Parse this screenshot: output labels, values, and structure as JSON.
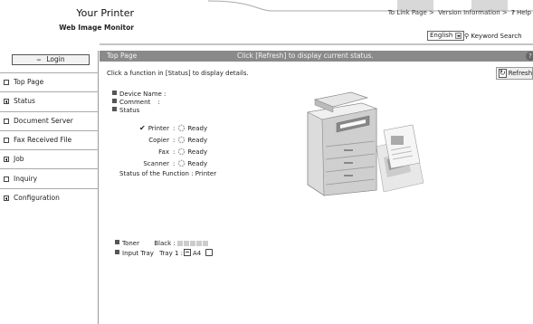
{
  "header": {
    "title": "Your Printer",
    "subtitle": "Web Image Monitor",
    "links": [
      "To Link Page >",
      "Version Information >",
      "Help"
    ],
    "help_icon": "question-icon",
    "language": "English",
    "keyword_search": "Keyword Search"
  },
  "sidebar": {
    "login": "Login",
    "items": [
      {
        "label": "Top Page",
        "icon": "page-box-icon"
      },
      {
        "label": "Status",
        "icon": "plus-box-icon"
      },
      {
        "label": "Document Server",
        "icon": "page-box-icon"
      },
      {
        "label": "Fax Received File",
        "icon": "page-box-icon"
      },
      {
        "label": "Job",
        "icon": "plus-box-icon"
      },
      {
        "label": "Inquiry",
        "icon": "page-box-icon"
      },
      {
        "label": "Configuration",
        "icon": "plus-box-icon"
      }
    ]
  },
  "main": {
    "bar_title": "Top Page",
    "bar_message": "Click [Refresh] to display current status.",
    "instruction": "Click a function in [Status] to display details.",
    "refresh_label": "Refresh",
    "device_name_label": "Device Name :",
    "comment_label": "Comment",
    "comment_colon": ":",
    "status_label": "Status",
    "functions": [
      {
        "name": "Printer",
        "state": "Ready",
        "checked": true
      },
      {
        "name": "Copier",
        "state": "Ready",
        "checked": false
      },
      {
        "name": "Fax",
        "state": "Ready",
        "checked": false
      },
      {
        "name": "Scanner",
        "state": "Ready",
        "checked": false
      }
    ],
    "function_status": "Status of the Function : Printer",
    "toner_label": "Toner",
    "toner_color": "Black :",
    "toner_level": 0,
    "input_tray_label": "Input Tray",
    "tray": "Tray 1 :",
    "paper_size": "A4"
  },
  "colors": {
    "bar": "#8a8a8a",
    "sidebar_border": "#999999",
    "toner_empty": "#cccccc"
  }
}
